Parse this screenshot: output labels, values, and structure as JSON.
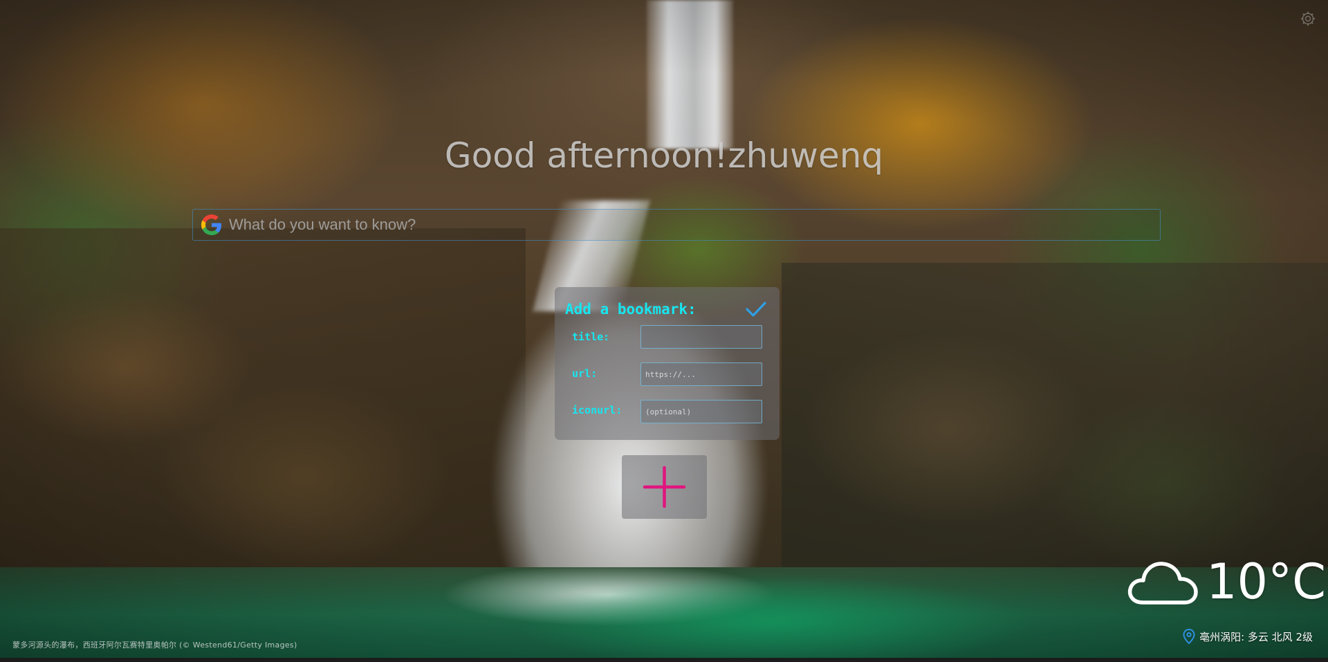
{
  "greeting": "Good afternoon!zhuwenq",
  "search": {
    "placeholder": "What do you want to know?",
    "engine_icon": "google-icon"
  },
  "bookmark_dialog": {
    "title": "Add a bookmark:",
    "confirm_icon": "check-icon",
    "fields": [
      {
        "label": "title:",
        "value": "",
        "placeholder": ""
      },
      {
        "label": "url:",
        "value": "",
        "placeholder": "https://..."
      },
      {
        "label": "iconurl:",
        "value": "",
        "placeholder": "(optional)"
      }
    ]
  },
  "add_button": {
    "icon": "plus-icon",
    "color": "#e0157e"
  },
  "weather": {
    "icon": "cloud-icon",
    "temperature": "10°C",
    "location": "亳州涡阳: 多云 北风 2级"
  },
  "caption": "蒙多河源头的瀑布，西班牙阿尔瓦赛特里奥帕尔 (© Westend61/Getty Images)",
  "colors": {
    "accent_cyan": "#17e6f0",
    "check_blue": "#2f9fe6",
    "plus_magenta": "#e0157e",
    "search_border": "#4696d2"
  }
}
